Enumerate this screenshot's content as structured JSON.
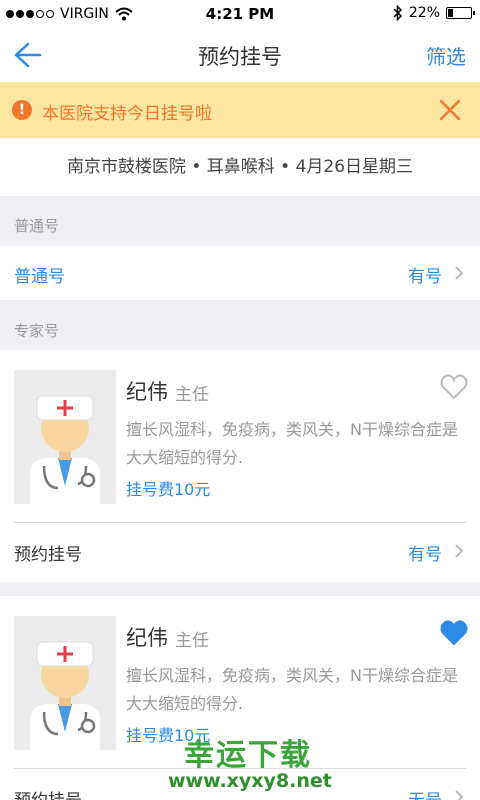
{
  "status_bar": {
    "carrier": "VIRGIN",
    "time": "4:21 PM",
    "battery": "22%"
  },
  "nav": {
    "title": "预约挂号",
    "filter_label": "筛选"
  },
  "notice": {
    "text": "本医院支持今日挂号啦"
  },
  "hospital_line": "南京市鼓楼医院 • 耳鼻喉科 • 4月26日星期三",
  "sections": {
    "general": {
      "header": "普通号",
      "row": {
        "label": "普通号",
        "status": "有号"
      }
    },
    "expert": {
      "header": "专家号"
    }
  },
  "doctors": [
    {
      "name": "纪伟",
      "title": "主任",
      "desc": "擅长风湿科，免疫病，类风关，N干燥综合症是大大缩短的得分.",
      "fee": "挂号费10元",
      "book_label": "预约挂号",
      "book_status": "有号",
      "favorite": false
    },
    {
      "name": "纪伟",
      "title": "主任",
      "desc": "擅长风湿科，免疫病，类风关，N干燥综合症是大大缩短的得分.",
      "fee": "挂号费10元",
      "book_label": "预约挂号",
      "book_status": "无号",
      "favorite": true
    }
  ],
  "watermark": {
    "text": "幸运下载",
    "url": "www.xyxy8.net"
  },
  "colors": {
    "accent": "#2b8be6",
    "notice_bg": "#fde6a0",
    "notice_fg": "#f0762e",
    "watermark": "#3aa63a"
  }
}
